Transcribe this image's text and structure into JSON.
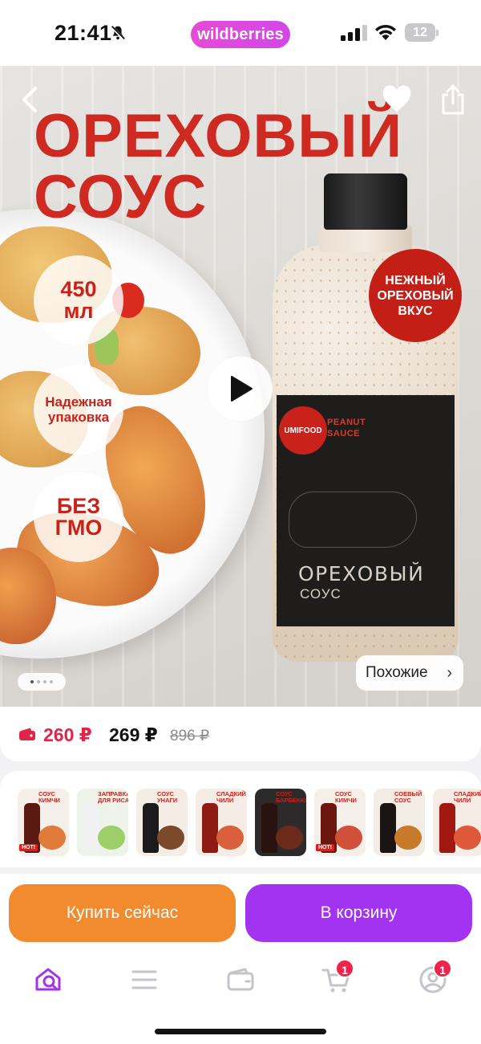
{
  "status_bar": {
    "time": "21:41",
    "brand": "wildberries",
    "battery": "12"
  },
  "hero": {
    "headline_line1": "ОРЕХОВЫЙ",
    "headline_line2": "СОУС",
    "badge_volume_line1": "450",
    "badge_volume_line2": "мл",
    "badge_pack_line1": "Надежная",
    "badge_pack_line2": "упаковка",
    "badge_gmo_line1": "БЕЗ",
    "badge_gmo_line2": "ГМО",
    "seal_line1": "НЕЖНЫЙ",
    "seal_line2": "ОРЕХОВЫЙ",
    "seal_line3": "ВКУС",
    "label_brand": "UMIFOOD",
    "label_peanut_line1": "PEANUT",
    "label_peanut_line2": "SAUCE",
    "label_title": "ОРЕХОВЫЙ",
    "label_subtitle": "СОУС",
    "similar_label": "Похожие",
    "pager_total": 4,
    "pager_active": 0
  },
  "price": {
    "wallet_price": "260 ₽",
    "price": "269 ₽",
    "old_price": "896 ₽"
  },
  "related": [
    {
      "label_line1": "СОУС",
      "label_line2": "КИМЧИ",
      "hot": "HOT!",
      "bottle_color": "#5a1a12",
      "dish_color": "#e07b3a",
      "bg": "#f4efe8"
    },
    {
      "label_line1": "ЗАПРАВКА",
      "label_line2": "ДЛЯ РИСА",
      "hot": "",
      "bottle_color": "#f1f1f1",
      "dish_color": "#9ccf6a",
      "bg": "#eef3ea"
    },
    {
      "label_line1": "СОУС",
      "label_line2": "УНАГИ",
      "hot": "",
      "bottle_color": "#1b1b1b",
      "dish_color": "#7a4a2a",
      "bg": "#f3ede6"
    },
    {
      "label_line1": "СЛАДКИЙ",
      "label_line2": "ЧИЛИ",
      "hot": "",
      "bottle_color": "#8e1c12",
      "dish_color": "#d9603c",
      "bg": "#f5ece6"
    },
    {
      "label_line1": "СОУС",
      "label_line2": "БАРБЕКЮ",
      "hot": "",
      "bottle_color": "#2a1210",
      "dish_color": "#6b2a1a",
      "bg": "#2c2a2a"
    },
    {
      "label_line1": "СОУС",
      "label_line2": "КИМЧИ",
      "hot": "HOT!",
      "bottle_color": "#6b160f",
      "dish_color": "#d0503a",
      "bg": "#f4efe8"
    },
    {
      "label_line1": "СОЕВЫЙ",
      "label_line2": "СОУС",
      "hot": "",
      "bottle_color": "#1a1412",
      "dish_color": "#c77a2a",
      "bg": "#f2ece4"
    },
    {
      "label_line1": "СЛАДКИЙ",
      "label_line2": "ЧИЛИ",
      "hot": "",
      "bottle_color": "#a0180f",
      "dish_color": "#e0583a",
      "bg": "#f5ece6"
    }
  ],
  "actions": {
    "buy_now": "Купить сейчас",
    "add_to_cart": "В корзину"
  },
  "tabbar": {
    "cart_badge": "1",
    "profile_badge": "1",
    "active_color": "#a233f0",
    "inactive_color": "#c4c4cc"
  }
}
